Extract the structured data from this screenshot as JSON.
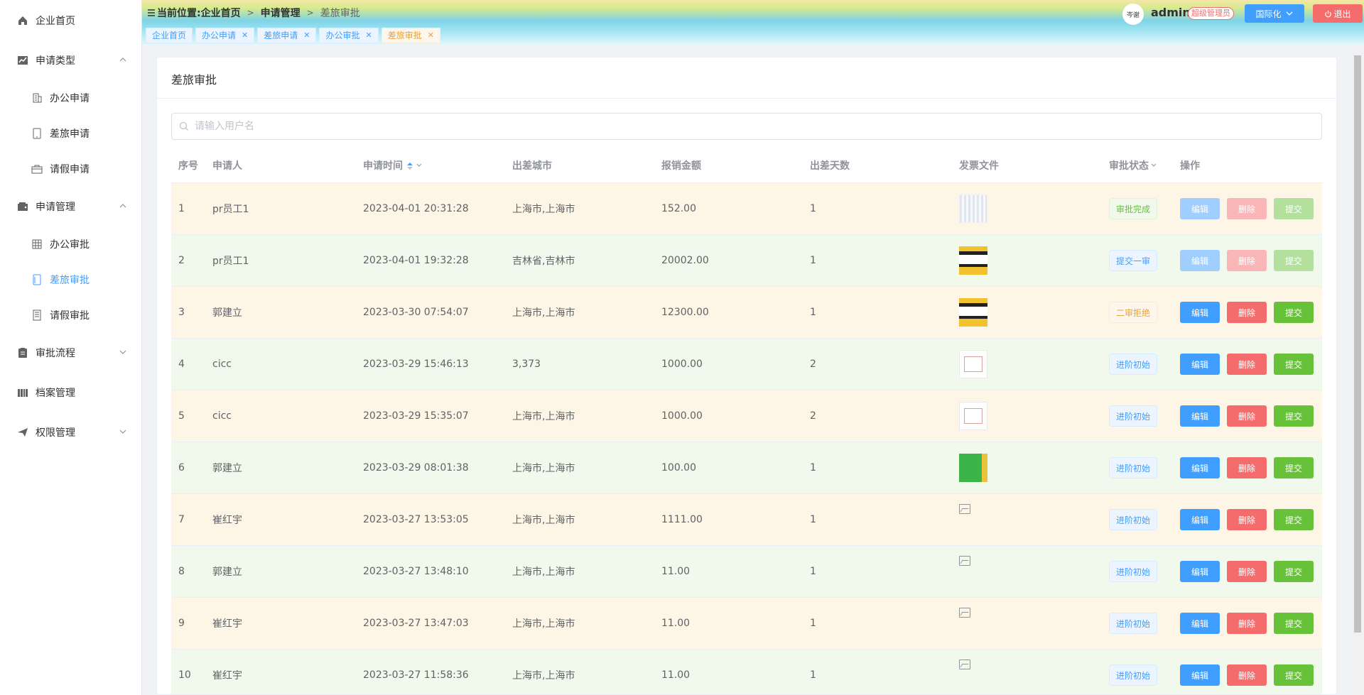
{
  "sidebar": {
    "items": [
      {
        "label": "企业首页",
        "icon": "home-icon"
      },
      {
        "label": "申请类型",
        "icon": "chart-icon",
        "expanded": true
      },
      {
        "label": "办公申请",
        "icon": "building-icon"
      },
      {
        "label": "差旅申请",
        "icon": "tablet-icon"
      },
      {
        "label": "请假申请",
        "icon": "briefcase-icon"
      },
      {
        "label": "申请管理",
        "icon": "wallet-icon",
        "expanded": true
      },
      {
        "label": "办公审批",
        "icon": "grid-icon"
      },
      {
        "label": "差旅审批",
        "icon": "tablet-icon",
        "active": true
      },
      {
        "label": "请假审批",
        "icon": "document-icon"
      },
      {
        "label": "审批流程",
        "icon": "clipboard-icon"
      },
      {
        "label": "档案管理",
        "icon": "bars-icon"
      },
      {
        "label": "权限管理",
        "icon": "send-icon"
      }
    ]
  },
  "header": {
    "breadcrumb": [
      "当前位置:企业首页",
      "申请管理",
      "差旅审批"
    ],
    "tags": [
      {
        "label": "企业首页",
        "closable": false
      },
      {
        "label": "办公申请",
        "closable": true
      },
      {
        "label": "差旅申请",
        "closable": true
      },
      {
        "label": "办公审批",
        "closable": true
      },
      {
        "label": "差旅审批",
        "closable": true,
        "current": true
      }
    ],
    "avatar_text": "岑谢",
    "username": "admin",
    "role": "超级管理员",
    "intl_label": "国际化",
    "logout_label": "退出"
  },
  "page": {
    "title": "差旅审批",
    "search_placeholder": "请输入用户名"
  },
  "table": {
    "columns": [
      "序号",
      "申请人",
      "申请时间",
      "出差城市",
      "报销金额",
      "出差天数",
      "发票文件",
      "审批状态",
      "操作"
    ],
    "actions": [
      "编辑",
      "删除",
      "提交"
    ],
    "rows": [
      {
        "no": "1",
        "applicant": "pr员工1",
        "time": "2023-04-01 20:31:28",
        "city": "上海市,上海市",
        "amount": "152.00",
        "days": "1",
        "invoice": "receipt",
        "status": "审批完成",
        "status_type": "ok",
        "actions_enabled": false
      },
      {
        "no": "2",
        "applicant": "pr员工1",
        "time": "2023-04-01 19:32:28",
        "city": "吉林省,吉林市",
        "amount": "20002.00",
        "days": "1",
        "invoice": "poster",
        "status": "提交一审",
        "status_type": "info",
        "actions_enabled": false
      },
      {
        "no": "3",
        "applicant": "郭建立",
        "time": "2023-03-30 07:54:07",
        "city": "上海市,上海市",
        "amount": "12300.00",
        "days": "1",
        "invoice": "poster",
        "status": "二审拒绝",
        "status_type": "warn",
        "actions_enabled": true
      },
      {
        "no": "4",
        "applicant": "cicc",
        "time": "2023-03-29 15:46:13",
        "city": "3,373",
        "amount": "1000.00",
        "days": "2",
        "invoice": "form",
        "status": "进阶初始",
        "status_type": "info",
        "actions_enabled": true
      },
      {
        "no": "5",
        "applicant": "cicc",
        "time": "2023-03-29 15:35:07",
        "city": "上海市,上海市",
        "amount": "1000.00",
        "days": "2",
        "invoice": "form",
        "status": "进阶初始",
        "status_type": "info",
        "actions_enabled": true
      },
      {
        "no": "6",
        "applicant": "郭建立",
        "time": "2023-03-29 08:01:38",
        "city": "上海市,上海市",
        "amount": "100.00",
        "days": "1",
        "invoice": "green",
        "status": "进阶初始",
        "status_type": "info",
        "actions_enabled": true
      },
      {
        "no": "7",
        "applicant": "崔红宇",
        "time": "2023-03-27 13:53:05",
        "city": "上海市,上海市",
        "amount": "1111.00",
        "days": "1",
        "invoice": "broken",
        "status": "进阶初始",
        "status_type": "info",
        "actions_enabled": true
      },
      {
        "no": "8",
        "applicant": "郭建立",
        "time": "2023-03-27 13:48:10",
        "city": "上海市,上海市",
        "amount": "11.00",
        "days": "1",
        "invoice": "broken",
        "status": "进阶初始",
        "status_type": "info",
        "actions_enabled": true
      },
      {
        "no": "9",
        "applicant": "崔红宇",
        "time": "2023-03-27 13:47:03",
        "city": "上海市,上海市",
        "amount": "11.00",
        "days": "1",
        "invoice": "broken",
        "status": "进阶初始",
        "status_type": "info",
        "actions_enabled": true
      },
      {
        "no": "10",
        "applicant": "崔红宇",
        "time": "2023-03-27 11:58:36",
        "city": "上海市,上海市",
        "amount": "11.00",
        "days": "1",
        "invoice": "broken",
        "status": "进阶初始",
        "status_type": "info",
        "actions_enabled": true
      }
    ]
  },
  "colors": {
    "primary": "#409eff",
    "danger": "#f56c6c",
    "success": "#67c23a",
    "warning": "#e6a23c"
  }
}
